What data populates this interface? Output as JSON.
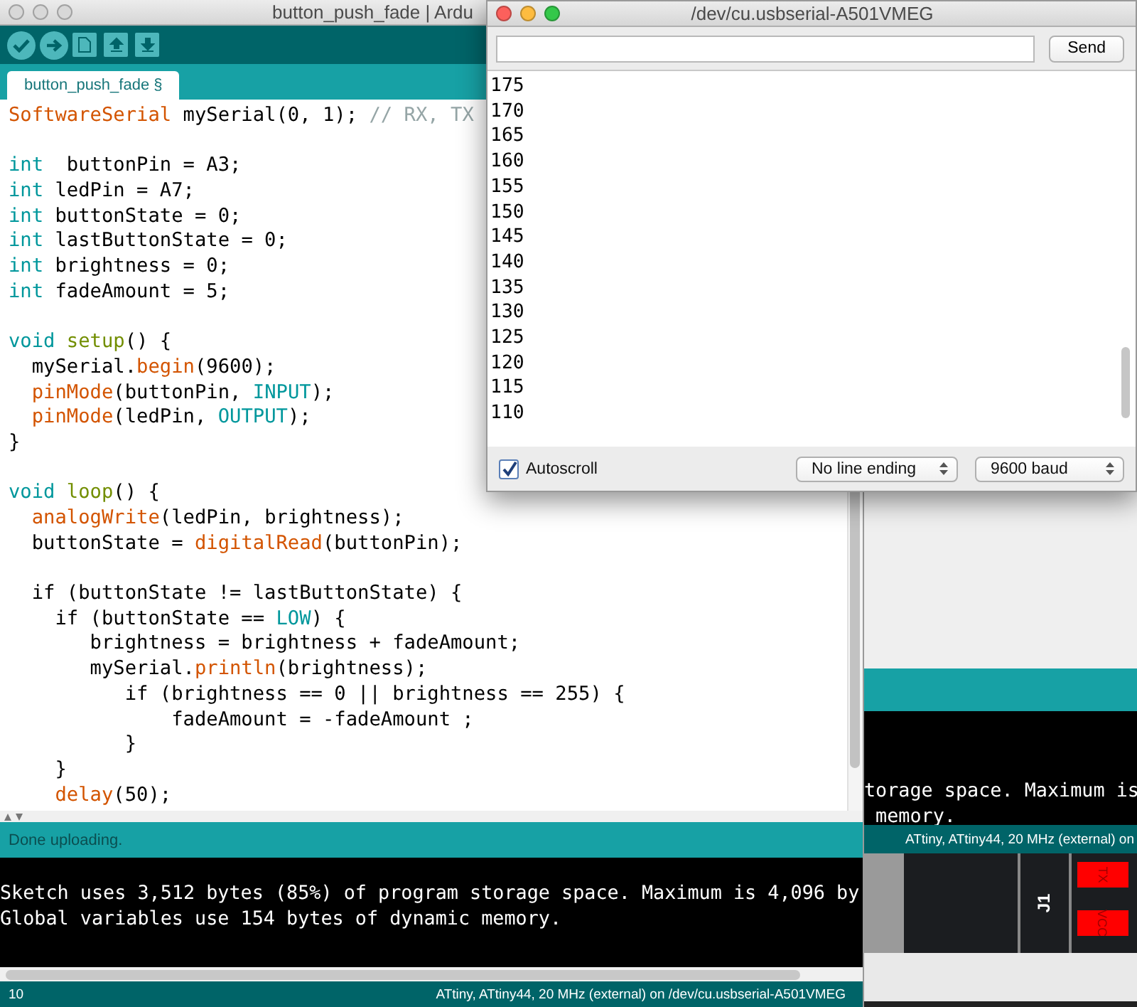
{
  "editor_window": {
    "title": "button_push_fade | Ardu",
    "active": false,
    "tabs": [
      {
        "label": "button_push_fade §",
        "selected": true
      }
    ],
    "code_blocks": [
      {
        "lines": [
          {
            "tokens": [
              {
                "text": "SoftwareSerial",
                "kind": "function"
              },
              {
                "text": " mySerial(0, 1); ",
                "kind": "plain"
              },
              {
                "text": "// RX, TX",
                "kind": "comment"
              }
            ]
          }
        ]
      },
      {
        "lines": [
          {
            "tokens": [
              {
                "text": "int",
                "kind": "keyword"
              },
              {
                "text": "  buttonPin = A3;",
                "kind": "plain"
              }
            ]
          },
          {
            "tokens": [
              {
                "text": "int",
                "kind": "keyword"
              },
              {
                "text": " ledPin = A7;",
                "kind": "plain"
              }
            ]
          },
          {
            "tokens": [
              {
                "text": "int",
                "kind": "keyword"
              },
              {
                "text": " buttonState = 0;",
                "kind": "plain"
              }
            ]
          },
          {
            "tokens": [
              {
                "text": "int",
                "kind": "keyword"
              },
              {
                "text": " lastButtonState = 0;",
                "kind": "plain"
              }
            ]
          },
          {
            "tokens": [
              {
                "text": "int",
                "kind": "keyword"
              },
              {
                "text": " brightness = 0;",
                "kind": "plain"
              }
            ]
          },
          {
            "tokens": [
              {
                "text": "int",
                "kind": "keyword"
              },
              {
                "text": " fadeAmount = 5;",
                "kind": "plain"
              }
            ]
          }
        ]
      },
      {
        "lines": [
          {
            "tokens": [
              {
                "text": "void",
                "kind": "keyword"
              },
              {
                "text": " setup",
                "kind": "structure"
              },
              {
                "text": "() {",
                "kind": "plain"
              }
            ]
          },
          {
            "tokens": [
              {
                "text": "  mySerial.",
                "kind": "plain"
              },
              {
                "text": "begin",
                "kind": "function"
              },
              {
                "text": "(9600);",
                "kind": "plain"
              }
            ]
          },
          {
            "tokens": [
              {
                "text": "  pinMode",
                "kind": "function"
              },
              {
                "text": "(buttonPin, ",
                "kind": "plain"
              },
              {
                "text": "INPUT",
                "kind": "keyword"
              },
              {
                "text": ");",
                "kind": "plain"
              }
            ]
          },
          {
            "tokens": [
              {
                "text": "  pinMode",
                "kind": "function"
              },
              {
                "text": "(ledPin, ",
                "kind": "plain"
              },
              {
                "text": "OUTPUT",
                "kind": "keyword"
              },
              {
                "text": ");",
                "kind": "plain"
              }
            ]
          },
          {
            "tokens": [
              {
                "text": "}",
                "kind": "plain"
              }
            ]
          }
        ]
      },
      {
        "lines": [
          {
            "tokens": [
              {
                "text": "void",
                "kind": "keyword"
              },
              {
                "text": " loop",
                "kind": "structure"
              },
              {
                "text": "() {",
                "kind": "plain"
              }
            ]
          },
          {
            "tokens": [
              {
                "text": "  analogWrite",
                "kind": "function"
              },
              {
                "text": "(ledPin, brightness);",
                "kind": "plain"
              }
            ]
          },
          {
            "tokens": [
              {
                "text": "  buttonState = ",
                "kind": "plain"
              },
              {
                "text": "digitalRead",
                "kind": "function"
              },
              {
                "text": "(buttonPin);",
                "kind": "plain"
              }
            ]
          }
        ]
      },
      {
        "lines": [
          {
            "tokens": [
              {
                "text": "  if (buttonState != lastButtonState) {",
                "kind": "plain"
              }
            ]
          },
          {
            "tokens": [
              {
                "text": "    if (buttonState == ",
                "kind": "plain"
              },
              {
                "text": "LOW",
                "kind": "keyword"
              },
              {
                "text": ") {",
                "kind": "plain"
              }
            ]
          },
          {
            "tokens": [
              {
                "text": "       brightness = brightness + fadeAmount;",
                "kind": "plain"
              }
            ]
          },
          {
            "tokens": [
              {
                "text": "       mySerial.",
                "kind": "plain"
              },
              {
                "text": "println",
                "kind": "function"
              },
              {
                "text": "(brightness);",
                "kind": "plain"
              }
            ]
          },
          {
            "tokens": [
              {
                "text": "          if (brightness == 0 || brightness == 255) {",
                "kind": "plain"
              }
            ]
          },
          {
            "tokens": [
              {
                "text": "              fadeAmount = -fadeAmount ;",
                "kind": "plain"
              }
            ]
          },
          {
            "tokens": [
              {
                "text": "          }",
                "kind": "plain"
              }
            ]
          },
          {
            "tokens": [
              {
                "text": "    }",
                "kind": "plain"
              }
            ]
          },
          {
            "tokens": [
              {
                "text": "    delay",
                "kind": "function"
              },
              {
                "text": "(50);",
                "kind": "plain"
              }
            ]
          }
        ]
      }
    ],
    "status_message": "Done uploading.",
    "console_lines": [
      "Sketch uses 3,512 bytes (85%) of program storage space. Maximum is 4,096 by",
      "Global variables use 154 bytes of dynamic memory."
    ],
    "footer": {
      "line_number": "10",
      "board": "ATtiny, ATtiny44, 20 MHz (external) on /dev/cu.usbserial-A501VMEG"
    }
  },
  "serial_monitor": {
    "title": "/dev/cu.usbserial-A501VMEG",
    "active": true,
    "send_button": "Send",
    "output_lines": [
      "175",
      "170",
      "165",
      "160",
      "155",
      "150",
      "145",
      "140",
      "135",
      "130",
      "125",
      "120",
      "115",
      "110"
    ],
    "autoscroll": {
      "label": "Autoscroll",
      "checked": true
    },
    "line_ending": "No line ending",
    "baud_rate": "9600 baud"
  },
  "background_window": {
    "console_lines": [
      "torage space. Maximum is",
      " memory."
    ],
    "status": "ATtiny, ATtiny44, 20 MHz (external) on",
    "connector": "J1",
    "pads": [
      {
        "label": "TX"
      },
      {
        "label": "VCC"
      }
    ]
  }
}
